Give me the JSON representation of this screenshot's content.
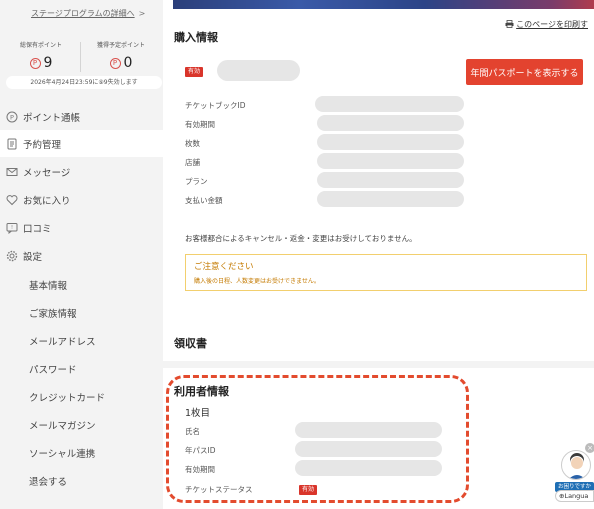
{
  "sidebar": {
    "stage_link": "ステージプログラムの詳細へ",
    "points_held_label": "総保有ポイント",
    "points_held_value": "9",
    "points_pending_label": "獲得予定ポイント",
    "points_pending_value": "0",
    "expiry_note": "2026年4月24日23:59に⑨9失効します",
    "nav": [
      {
        "label": "ポイント通帳",
        "icon": "point-icon"
      },
      {
        "label": "予約管理",
        "icon": "document-icon"
      },
      {
        "label": "メッセージ",
        "icon": "mail-icon"
      },
      {
        "label": "お気に入り",
        "icon": "heart-icon"
      },
      {
        "label": "口コミ",
        "icon": "review-icon"
      },
      {
        "label": "設定",
        "icon": "gear-icon"
      }
    ],
    "settings_items": [
      "基本情報",
      "ご家族情報",
      "メールアドレス",
      "パスワード",
      "クレジットカード",
      "メールマガジン",
      "ソーシャル連携",
      "退会する"
    ]
  },
  "main": {
    "print_link": "このページを印刷す",
    "purchase_title": "購入情報",
    "status_badge": "有効",
    "annual_pass_button": "年間パスポートを表示する",
    "fields": [
      "チケットブックID",
      "有効期間",
      "枚数",
      "店舗",
      "プラン",
      "支払い金額"
    ],
    "cancel_notice": "お客様都合によるキャンセル・返金・変更はお受けしておりません。",
    "caution_title": "ご注意ください",
    "caution_body": "購入後の日程、人数変更はお受けできません。",
    "receipt_title": "領収書",
    "user_info_title": "利用者情報",
    "sheet_label": "1枚目",
    "user_fields": [
      "氏名",
      "年パスID",
      "有効期間",
      "チケットステータス"
    ],
    "ticket_status_badge": "有効"
  },
  "chat_widget": {
    "label": "お困りですか",
    "language": "Langua"
  },
  "colors": {
    "accent_red": "#e3432f",
    "badge_red": "#d9352b",
    "caution_orange": "#c47a00",
    "caution_border": "#f2cf6e",
    "annotation_dash": "#e34b2e"
  }
}
